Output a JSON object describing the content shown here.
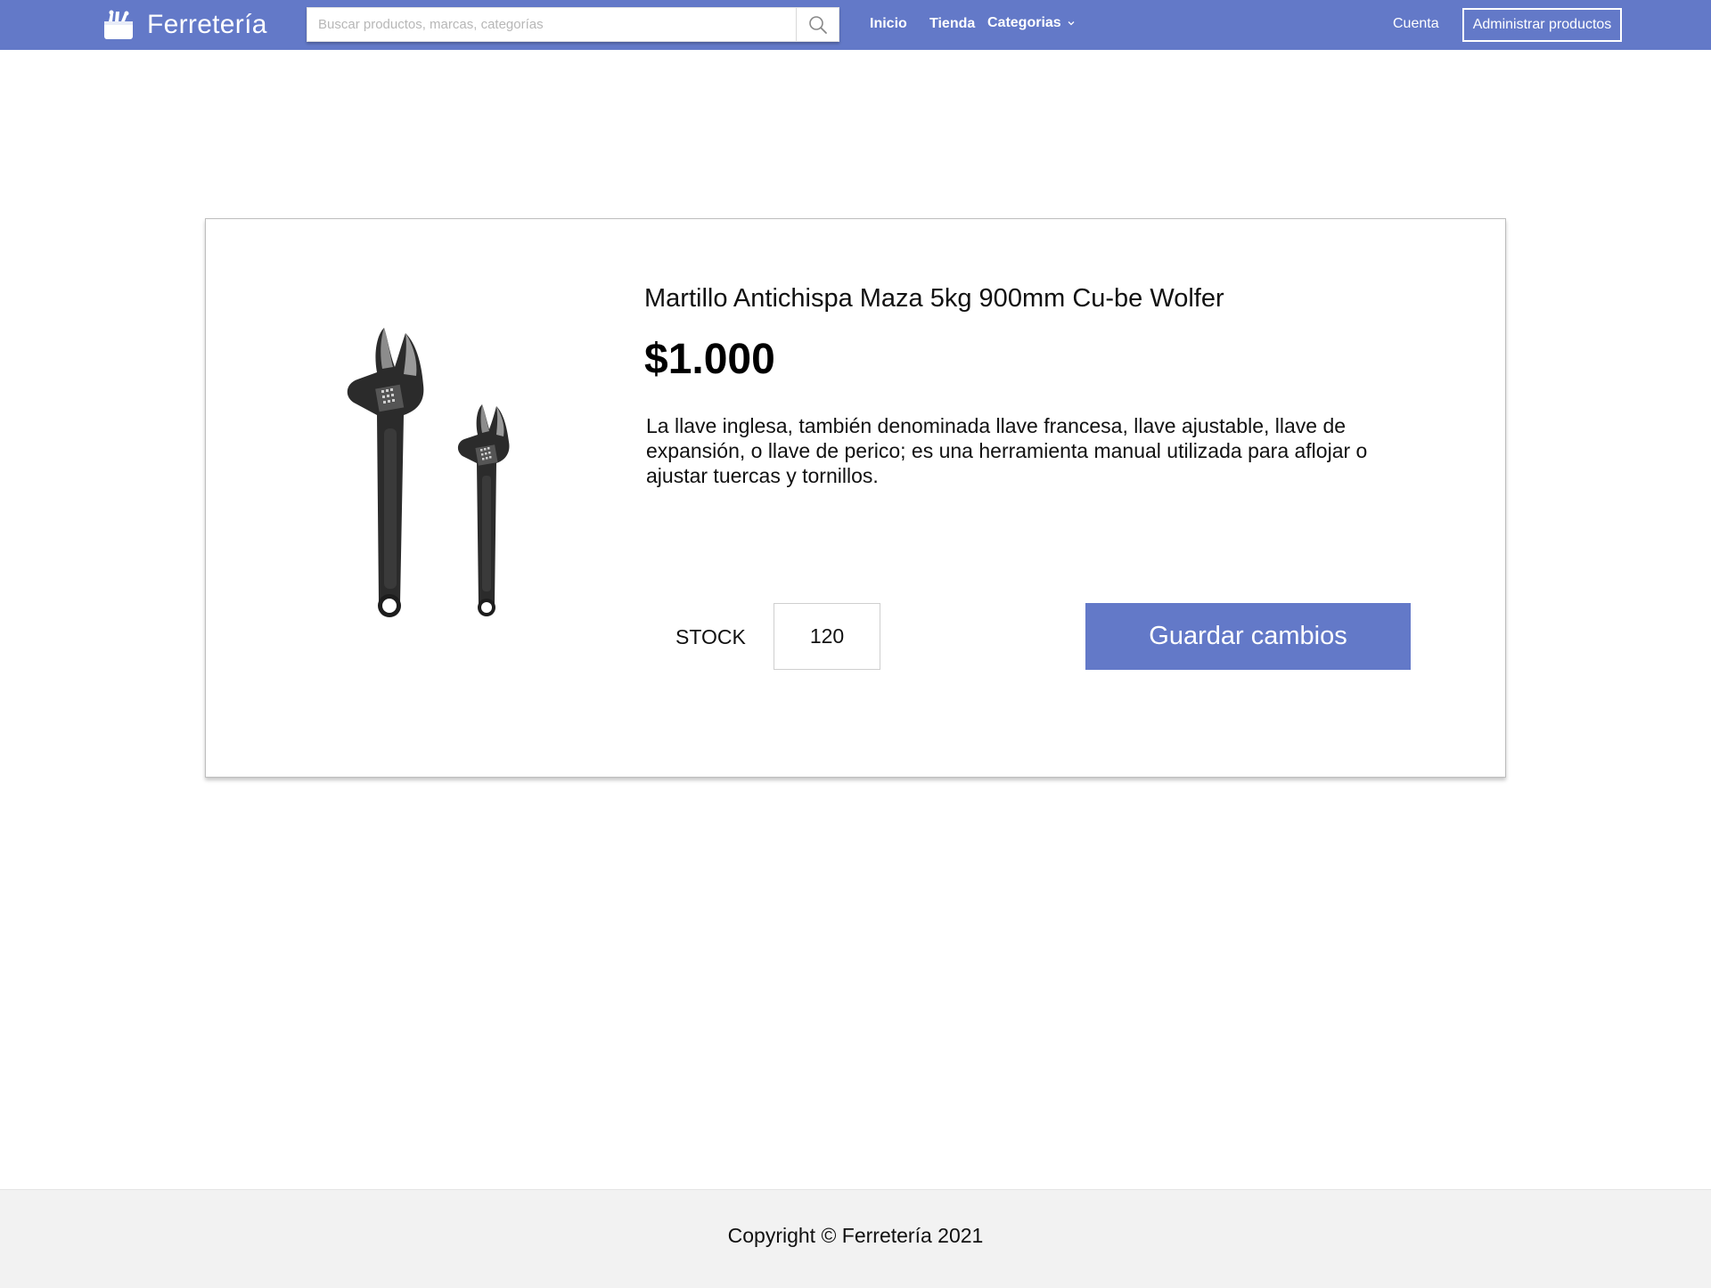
{
  "header": {
    "brand": "Ferretería",
    "search_placeholder": "Buscar productos, marcas, categorías",
    "nav": {
      "inicio": "Inicio",
      "tienda": "Tienda",
      "categorias": "Categorias"
    },
    "cuenta": "Cuenta",
    "admin_button": "Administrar productos",
    "color": "#6379c8"
  },
  "product": {
    "title": "Martillo Antichispa Maza 5kg 900mm Cu-be Wolfer",
    "price": "$1.000",
    "description": "La llave inglesa, también denominada llave francesa, llave ajustable, llave de expansión, o llave de perico; es una herramienta manual utilizada para aflojar o ajustar tuercas y tornillos.",
    "stock_label": "STOCK",
    "stock_value": "120",
    "save_button": "Guardar cambios",
    "image": "adjustable-wrenches-image"
  },
  "footer": {
    "copyright": "Copyright © Ferretería 2021"
  },
  "icons": {
    "brand": "toolbox-icon",
    "search": "search-icon",
    "dropdown": "chevron-down-icon"
  }
}
